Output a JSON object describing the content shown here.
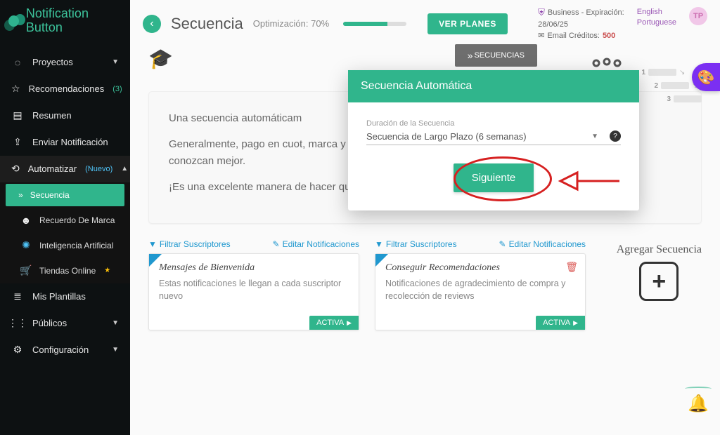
{
  "brand": "Notification Button",
  "sidebar": {
    "proyectos": "Proyectos",
    "recomendaciones": "Recomendaciones",
    "recomendaciones_count": "(3)",
    "resumen": "Resumen",
    "enviar": "Enviar Notificación",
    "automatizar": "Automatizar",
    "automatizar_tag": "(Nuevo)",
    "sub_secuencia": "Secuencia",
    "sub_recuerdo": "Recuerdo De Marca",
    "sub_ia": "Inteligencia Artificial",
    "sub_tiendas": "Tiendas Online",
    "plantillas": "Mis Plantillas",
    "publicos": "Públicos",
    "config": "Configuración"
  },
  "header": {
    "title": "Secuencia",
    "opt_label": "Optimización: 70%",
    "ver_planes": "VER PLANES",
    "plan_line": "Business - Expiración:",
    "plan_date": "28/06/25",
    "credits_label": "Email Créditos:",
    "credits_value": "500",
    "lang_en": "English",
    "lang_pt": "Portuguese",
    "avatar": "TP"
  },
  "pill": "SECUENCIAS",
  "info": {
    "p1": "Una secuencia automáticam",
    "p2": "Generalmente, pago en cuot, marca y cualquier otra información relevante para que tus visitantes te conozcan mejor.",
    "p3": "¡Es una excelente manera de hacer que tus visitantes regresen a tu sitio web!"
  },
  "filters": {
    "filter": "Filtrar Suscriptores",
    "edit": "Editar Notificaciones"
  },
  "cards": {
    "a_title": "Mensajes de Bienvenida",
    "a_desc": "Estas notificaciones le llegan a cada suscriptor nuevo",
    "b_title": "Conseguir Recomendaciones",
    "b_desc": "Notificaciones de agradecimiento de compra y recolección de reviews",
    "status": "ACTIVA"
  },
  "add_seq": "Agregar Secuencia",
  "modal": {
    "title": "Secuencia Automática",
    "field_label": "Duración de la Secuencia",
    "select_value": "Secuencia de Largo Plazo (6 semanas)",
    "next": "Siguiente"
  }
}
